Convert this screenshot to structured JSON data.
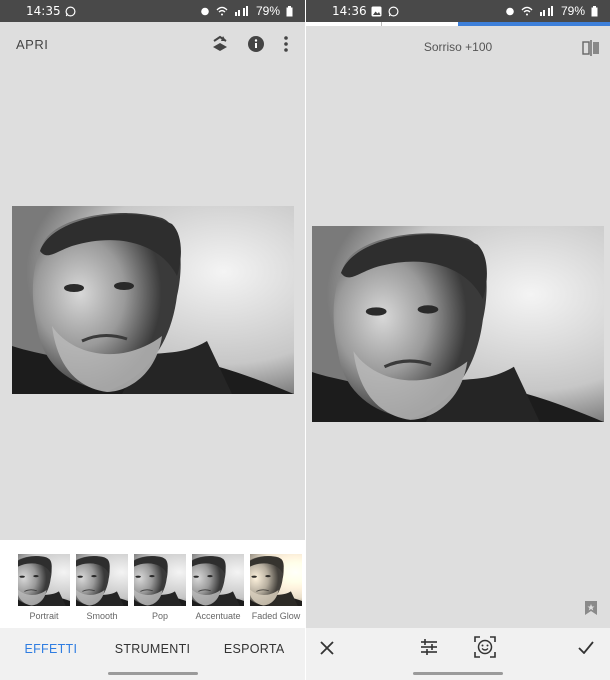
{
  "left": {
    "status": {
      "time": "14:35",
      "battery": "79%"
    },
    "header": {
      "open_label": "APRI"
    },
    "filters": [
      {
        "label": "Portrait"
      },
      {
        "label": "Smooth"
      },
      {
        "label": "Pop"
      },
      {
        "label": "Accentuate"
      },
      {
        "label": "Faded Glow"
      }
    ],
    "nav": {
      "effects": "EFFETTI",
      "tools": "STRUMENTI",
      "export": "ESPORTA"
    }
  },
  "right": {
    "status": {
      "time": "14:36",
      "battery": "79%"
    },
    "adjustment_label": "Sorriso +100"
  },
  "colors": {
    "accent": "#2f7de1",
    "progress": "#3d7fd9"
  },
  "icons": [
    "whatsapp-icon",
    "gallery-icon",
    "alarm-icon",
    "wifi-icon",
    "signal-icon",
    "battery-icon",
    "layers-icon",
    "info-icon",
    "more-icon",
    "compare-icon",
    "bookmark-icon",
    "close-icon",
    "sliders-icon",
    "face-icon",
    "check-icon"
  ]
}
